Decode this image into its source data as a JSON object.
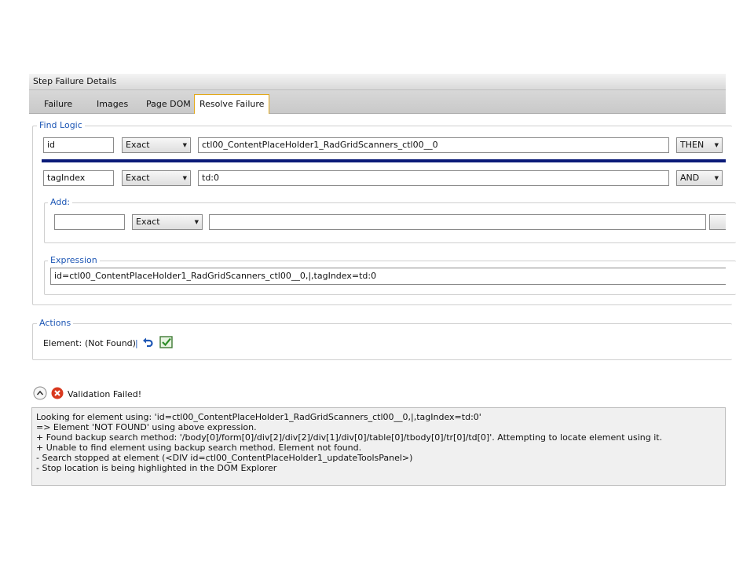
{
  "panel": {
    "title": "Step Failure Details"
  },
  "tabs": [
    {
      "label": "Failure"
    },
    {
      "label": "Images"
    },
    {
      "label": "Page DOM"
    },
    {
      "label": "Resolve Failure",
      "active": true
    }
  ],
  "find_logic": {
    "legend": "Find Logic",
    "rows": [
      {
        "attribute": "id",
        "comparison": "Exact",
        "value": "ctl00_ContentPlaceHolder1_RadGridScanners_ctl00__0",
        "operator": "THEN"
      },
      {
        "attribute": "tagIndex",
        "comparison": "Exact",
        "value": "td:0",
        "operator": "AND"
      }
    ],
    "add": {
      "legend": "Add:",
      "attribute": "",
      "comparison": "Exact",
      "value": ""
    },
    "expression": {
      "legend": "Expression",
      "value": "id=ctl00_ContentPlaceHolder1_RadGridScanners_ctl00__0,|,tagIndex=td:0"
    }
  },
  "actions": {
    "legend": "Actions",
    "element_label": "Element:",
    "element_status": "(Not Found)",
    "divider": "|"
  },
  "validation": {
    "status": "Validation Failed!",
    "log_lines": [
      "Looking for element using: 'id=ctl00_ContentPlaceHolder1_RadGridScanners_ctl00__0,|,tagIndex=td:0'",
      "=> Element 'NOT FOUND' using above expression.",
      "+ Found backup search method: '/body[0]/form[0]/div[2]/div[2]/div[1]/div[0]/table[0]/tbody[0]/tr[0]/td[0]'. Attempting to locate element using it.",
      "+ Unable to find element using backup search method. Element not found.",
      "- Search stopped at element (<DIV id=ctl00_ContentPlaceHolder1_updateToolsPanel>)",
      "- Stop location is being highlighted in the DOM Explorer"
    ]
  },
  "colors": {
    "accent": "#1e57b5",
    "error": "#d9391f",
    "separator": "#0a1a78",
    "tab_active_border": "#e3a919"
  }
}
